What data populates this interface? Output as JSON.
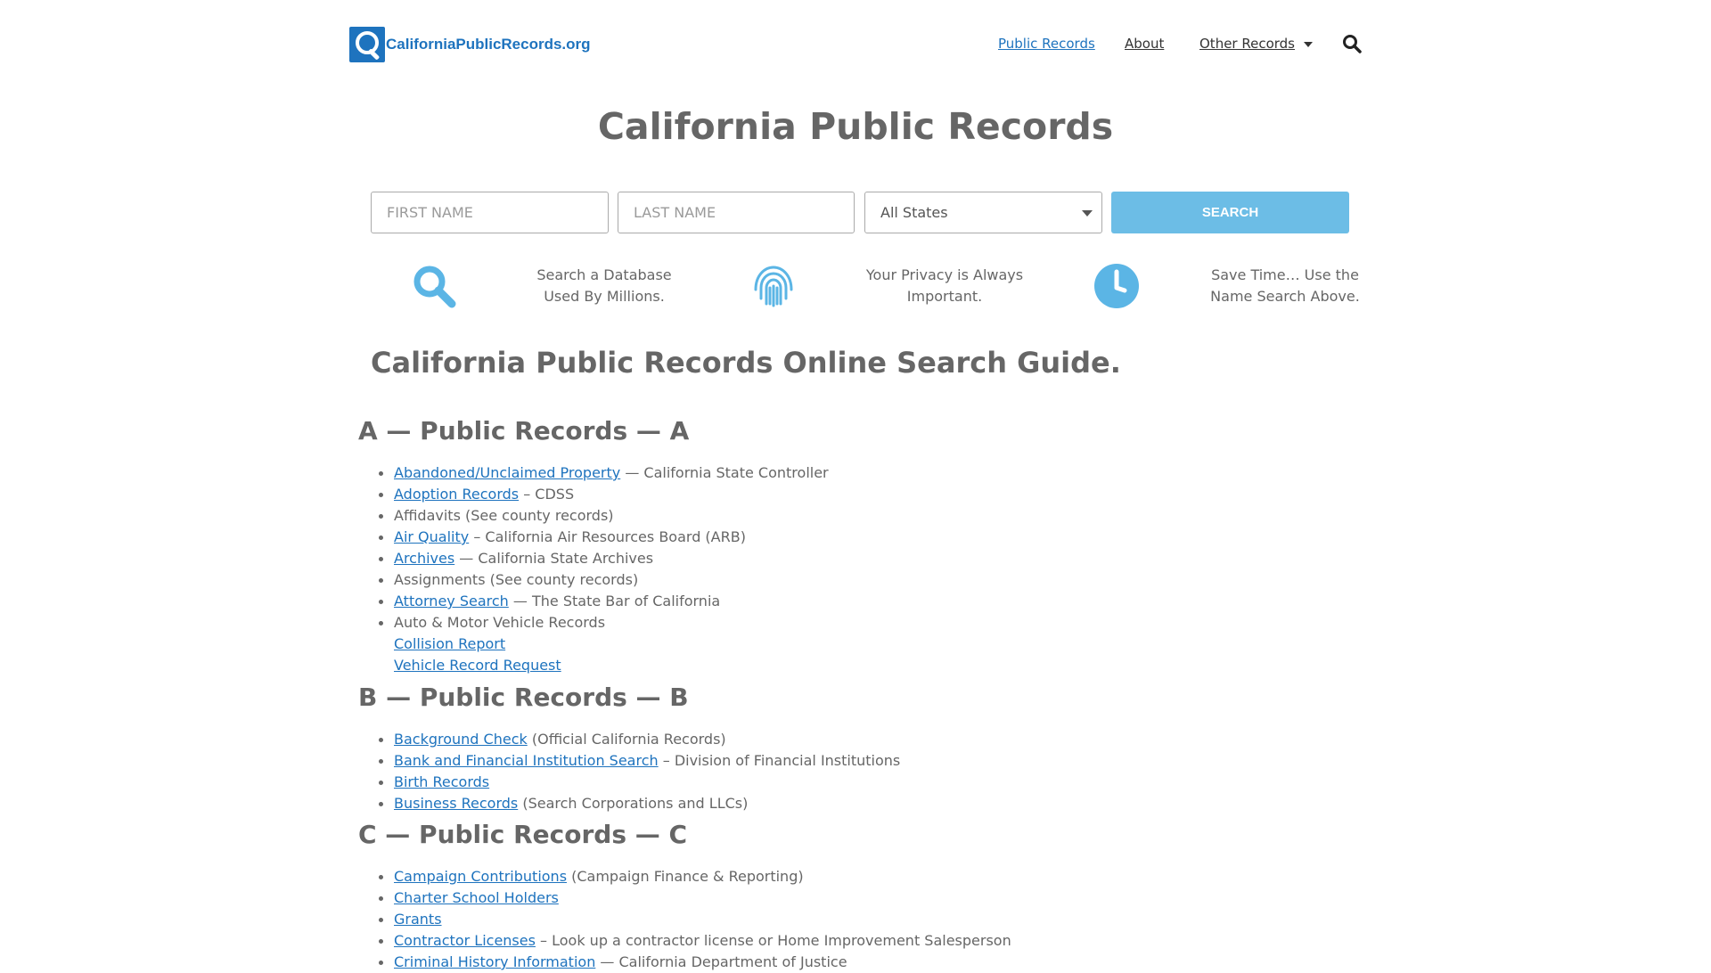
{
  "header": {
    "logo_text": "CaliforniaPublicRecords.org",
    "nav": {
      "public_records": "Public Records",
      "about": "About",
      "other_records": "Other Records"
    }
  },
  "hero": {
    "title": "California Public Records",
    "first_name_placeholder": "FIRST NAME",
    "last_name_placeholder": "LAST NAME",
    "state_selected": "All States",
    "search_button": "SEARCH"
  },
  "features": [
    {
      "icon": "magnifier-icon",
      "line1": "Search a Database",
      "line2": "Used By Millions."
    },
    {
      "icon": "fingerprint-icon",
      "line1": "Your Privacy is Always",
      "line2": "Important."
    },
    {
      "icon": "clock-icon",
      "line1": "Save Time… Use the",
      "line2": "Name Search Above."
    }
  ],
  "guide_title": "California Public Records Online Search Guide.",
  "sections": {
    "a": {
      "title": "A — Public Records — A",
      "items": [
        {
          "link": "Abandoned/Unclaimed Property",
          "text": " — California State Controller"
        },
        {
          "link": "Adoption Records",
          "text": " – CDSS"
        },
        {
          "link": "",
          "text": "Affidavits (See county records)"
        },
        {
          "link": "Air Quality",
          "text": " – California Air Resources Board (ARB)"
        },
        {
          "link": "Archives",
          "text": " — California State Archives"
        },
        {
          "link": "",
          "text": "Assignments (See county records)"
        },
        {
          "link": "Attorney Search",
          "text": " — The State Bar of California"
        },
        {
          "link": "",
          "text": "Auto & Motor Vehicle Records"
        },
        {
          "link": "Collision Report",
          "text": ""
        },
        {
          "link": "Vehicle Record Request",
          "text": ""
        }
      ]
    },
    "b": {
      "title": "B — Public Records — B",
      "items": [
        {
          "link": "Background Check",
          "text": " (Official California Records)"
        },
        {
          "link": "Bank and Financial Institution Search",
          "text": " – Division of Financial Institutions"
        },
        {
          "link": "Birth Records",
          "text": ""
        },
        {
          "link": "Business Records",
          "text": " (Search Corporations and LLCs)"
        }
      ]
    },
    "c": {
      "title": "C — Public Records — C",
      "items": [
        {
          "link": "Campaign Contributions",
          "text": " (Campaign Finance & Reporting)"
        },
        {
          "link": "Charter School Holders",
          "text": ""
        },
        {
          "link": "Grants",
          "text": ""
        },
        {
          "link": "Contractor Licenses",
          "text": " – Look up a contractor license or Home Improvement Salesperson"
        },
        {
          "link": "Criminal History Information",
          "text": " — California Department of Justice"
        }
      ]
    }
  },
  "colors": {
    "link": "#1e73be",
    "button": "#6cbde6",
    "icon": "#5bb5e5",
    "text": "#666666"
  }
}
